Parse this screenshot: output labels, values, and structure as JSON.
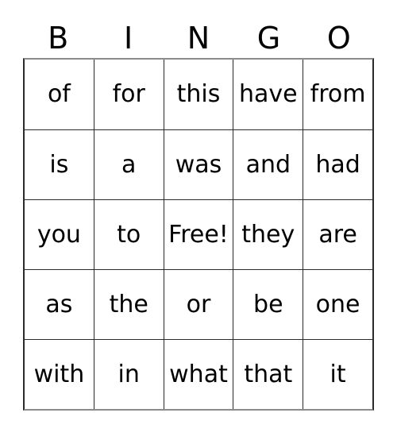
{
  "card": {
    "type": "bingo-card",
    "headers": [
      "B",
      "I",
      "N",
      "G",
      "O"
    ],
    "free_space_label": "Free!",
    "free_space_position": {
      "row": 3,
      "column": 3
    },
    "rows": [
      {
        "cells": [
          "of",
          "for",
          "this",
          "have",
          "from"
        ]
      },
      {
        "cells": [
          "is",
          "a",
          "was",
          "and",
          "had"
        ]
      },
      {
        "cells": [
          "you",
          "to",
          "Free!",
          "they",
          "are"
        ]
      },
      {
        "cells": [
          "as",
          "the",
          "or",
          "be",
          "one"
        ]
      },
      {
        "cells": [
          "with",
          "in",
          "what",
          "that",
          "it"
        ]
      }
    ]
  },
  "colors": {
    "background": "#ffffff",
    "text": "#000000",
    "grid_line": "#2b2b2b",
    "outer_edge": "#8b8b8b"
  }
}
